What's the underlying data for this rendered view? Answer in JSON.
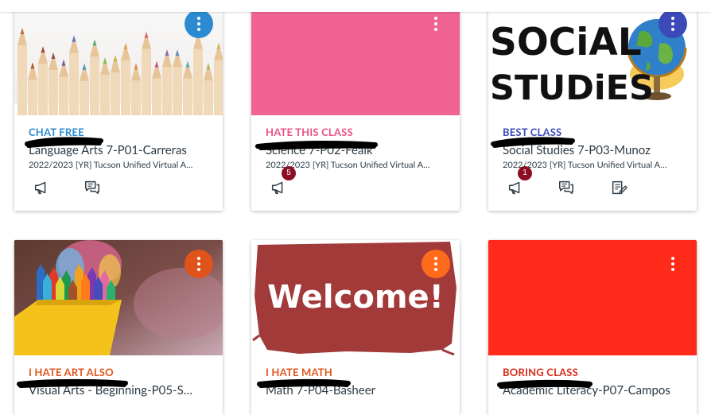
{
  "cards": [
    {
      "nickname": "CHAT FREE",
      "title": "Language Arts 7-P01-Carreras",
      "term": "2022/2023 [YR] Tucson Unified Virtual A…",
      "accent": "#2b8ad1",
      "nick_color": "#2b8ad1",
      "image": "colored-pencils",
      "actions": [
        {
          "icon": "announcements-icon",
          "badge": ""
        },
        {
          "icon": "discussions-icon",
          "badge": ""
        }
      ]
    },
    {
      "nickname": "HATE THIS CLASS",
      "title": "Science 7-P02-Feaik",
      "term": "2022/2023 [YR] Tucson Unified Virtual A…",
      "accent": "#f06292",
      "nick_color": "#e94f86",
      "image": "solid-pink",
      "actions": [
        {
          "icon": "announcements-icon",
          "badge": "5"
        }
      ]
    },
    {
      "nickname": "BEST CLASS",
      "title": "Social Studies 7-P03-Munoz",
      "term": "2022/2023 [YR] Tucson Unified Virtual A…",
      "accent": "#3b4ab8",
      "nick_color": "#3b4ab8",
      "image": "social-studies-globe",
      "image_text_top": "SOCiAL",
      "image_text_bottom": "STUDiES",
      "actions": [
        {
          "icon": "announcements-icon",
          "badge": "1"
        },
        {
          "icon": "discussions-icon",
          "badge": ""
        },
        {
          "icon": "assignments-icon",
          "badge": ""
        }
      ]
    },
    {
      "nickname": "I HATE ART ALSO",
      "title": "Visual Arts - Beginning-P05-S…",
      "term": "",
      "accent": "#e0541b",
      "nick_color": "#e0541b",
      "image": "crayons"
    },
    {
      "nickname": "I HATE MATH",
      "title": "Math 7-P04-Basheer",
      "term": "",
      "accent": "#ff6b1a",
      "nick_color": "#e0541b",
      "image": "welcome-paint",
      "image_text": "Welcome!"
    },
    {
      "nickname": "BORING CLASS",
      "title": "Academic Literacy-P07-Campos",
      "term": "",
      "accent": "#ff2a1a",
      "nick_color": "#d92b1a",
      "image": "solid-red"
    }
  ]
}
